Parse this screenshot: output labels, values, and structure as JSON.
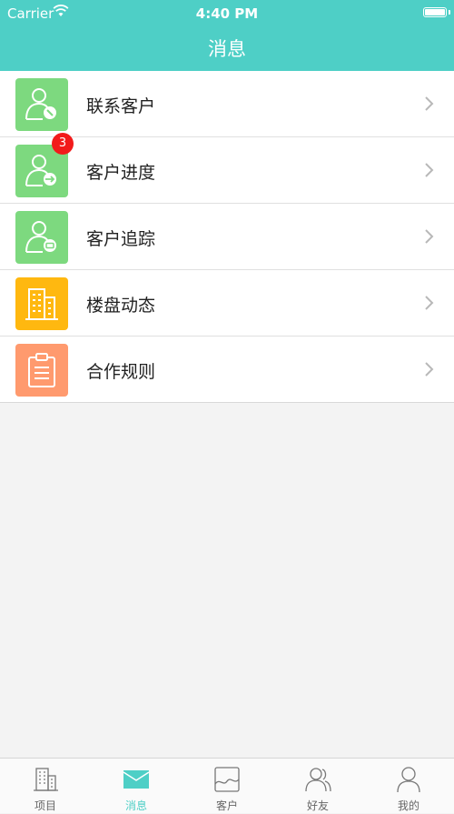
{
  "status_bar": {
    "carrier": "Carrier",
    "time": "4:40 PM"
  },
  "header": {
    "title": "消息"
  },
  "menu": [
    {
      "label": "联系客户",
      "icon": "contact-phone-icon",
      "color": "#7dd97f",
      "badge": ""
    },
    {
      "label": "客户进度",
      "icon": "contact-progress-icon",
      "color": "#7dd97f",
      "badge": "3"
    },
    {
      "label": "客户追踪",
      "icon": "contact-track-icon",
      "color": "#7dd97f",
      "badge": ""
    },
    {
      "label": "楼盘动态",
      "icon": "building-icon",
      "color": "#ffb810",
      "badge": ""
    },
    {
      "label": "合作规则",
      "icon": "clipboard-icon",
      "color": "#ff9a6e",
      "badge": ""
    }
  ],
  "tabs": [
    {
      "label": "项目",
      "icon": "building-tab-icon",
      "active": false
    },
    {
      "label": "消息",
      "icon": "envelope-tab-icon",
      "active": true
    },
    {
      "label": "客户",
      "icon": "customer-tab-icon",
      "active": false
    },
    {
      "label": "好友",
      "icon": "friends-tab-icon",
      "active": false
    },
    {
      "label": "我的",
      "icon": "profile-tab-icon",
      "active": false
    }
  ],
  "colors": {
    "accent": "#4ecfc6",
    "badge": "#f21b1b"
  }
}
